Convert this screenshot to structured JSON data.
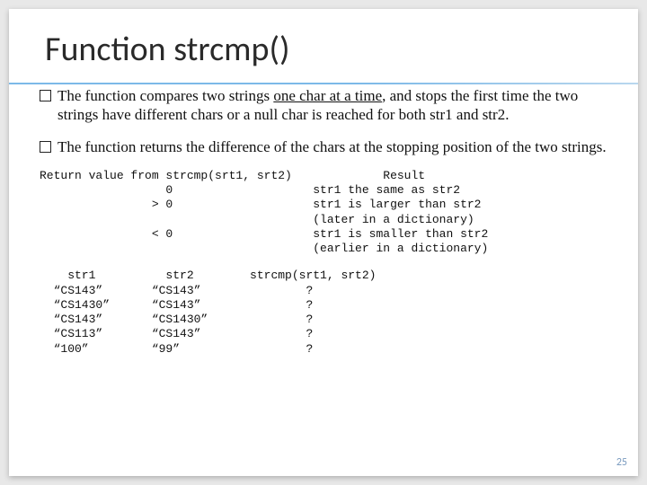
{
  "title": "Function strcmp()",
  "bullets": [
    {
      "pre": "The function compares two strings ",
      "underlined": "one char at a time",
      "post": ", and stops the first time the two strings have different chars or a null char is reached for both str1 and str2."
    },
    {
      "pre": "The function returns the difference of the chars at the stopping position of the two strings.",
      "underlined": "",
      "post": ""
    }
  ],
  "mono1": "Return value from strcmp(srt1, srt2)             Result\n                  0                    str1 the same as str2\n                > 0                    str1 is larger than str2\n                                       (later in a dictionary)\n                < 0                    str1 is smaller than str2\n                                       (earlier in a dictionary)",
  "mono2": "    str1          str2        strcmp(srt1, srt2)\n  “CS143”       “CS143”               ?\n  “CS1430”      “CS143”               ?\n  “CS143”       “CS1430”              ?\n  “CS113”       “CS143”               ?\n  “100”         “99”                  ?",
  "page": "25"
}
